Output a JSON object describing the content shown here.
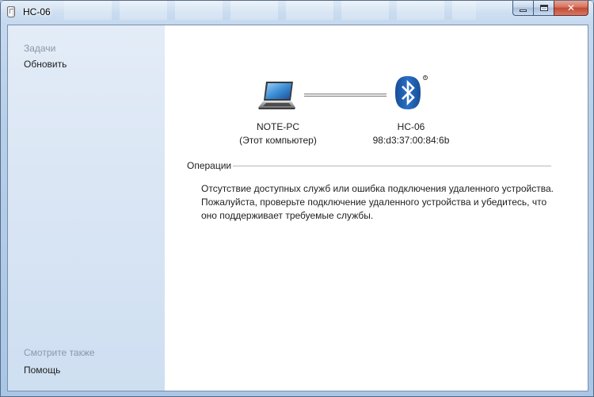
{
  "window": {
    "title": "HC-06",
    "controls": {
      "minimize": "minimize-icon",
      "maximize": "maximize-icon",
      "close": "close-icon"
    }
  },
  "taskpane": {
    "tasks_heading": "Задачи",
    "refresh_link": "Обновить",
    "see_also_heading": "Смотрите также",
    "help_link": "Помощь"
  },
  "devices": {
    "computer": {
      "name": "NOTE-PC",
      "subtitle": "(Этот компьютер)",
      "icon": "laptop-icon"
    },
    "remote": {
      "name": "HC-06",
      "address": "98:d3:37:00:84:6b",
      "icon": "bluetooth-icon"
    }
  },
  "operations": {
    "heading": "Операции",
    "message_lines": [
      "Отсутствие доступных служб или ошибка подключения удаленного устройства.",
      "Пожалуйста, проверьте подключение удаленного устройства и убедитесь, что",
      "оно поддерживает требуемые службы."
    ]
  },
  "colors": {
    "bluetooth_blue": "#1f5fb0",
    "taskpane_bg": "#d9e5f4",
    "muted_heading": "#8a98a8"
  }
}
